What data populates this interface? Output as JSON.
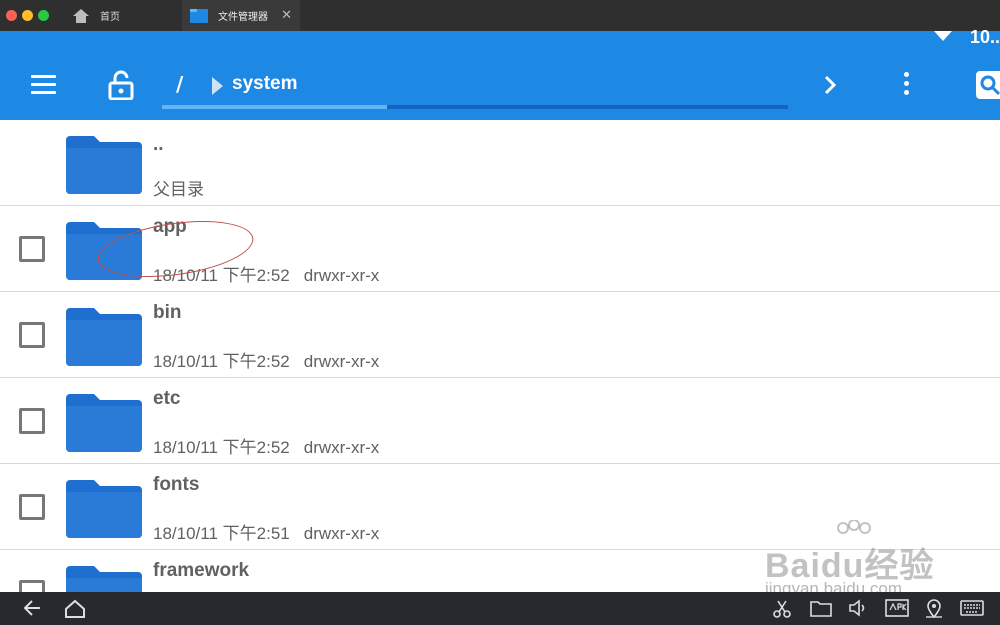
{
  "tabs": [
    {
      "label": "首页",
      "icon": "home-icon"
    },
    {
      "label": "文件管理器",
      "icon": "folder-icon",
      "close": "✕"
    }
  ],
  "status": {
    "clock": "10.."
  },
  "toolbar": {
    "breadcrumb_root": "/",
    "breadcrumb_current": "system",
    "loading_progress": 0.36
  },
  "files": [
    {
      "name": "..",
      "meta": "父目录",
      "perm": "",
      "has_checkbox": false
    },
    {
      "name": "app",
      "meta": "18/10/11 下午2:52",
      "perm": "drwxr-xr-x",
      "has_checkbox": true
    },
    {
      "name": "bin",
      "meta": "18/10/11 下午2:52",
      "perm": "drwxr-xr-x",
      "has_checkbox": true
    },
    {
      "name": "etc",
      "meta": "18/10/11 下午2:52",
      "perm": "drwxr-xr-x",
      "has_checkbox": true
    },
    {
      "name": "fonts",
      "meta": "18/10/11 下午2:51",
      "perm": "drwxr-xr-x",
      "has_checkbox": true
    },
    {
      "name": "framework",
      "meta": "",
      "perm": "",
      "has_checkbox": true
    }
  ],
  "watermark": {
    "brand": "Baidu经验",
    "url": "jingyan.baidu.com"
  },
  "colors": {
    "accent": "#1e88e5",
    "folder": "#1e6fd0",
    "text": "#616161"
  }
}
